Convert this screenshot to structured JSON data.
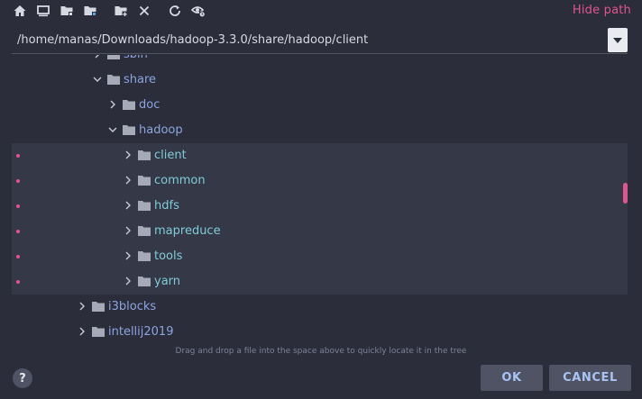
{
  "toolbar": {
    "icons": [
      "home-icon",
      "monitor-icon",
      "folder-up-icon",
      "folder-current-icon",
      "new-folder-icon",
      "delete-icon",
      "refresh-icon",
      "show-hidden-icon"
    ],
    "hide_path_label": "Hide path"
  },
  "path": {
    "value": "/home/manas/Downloads/hadoop-3.3.0/share/hadoop/client"
  },
  "tree": {
    "rows": [
      {
        "label": "sbin",
        "expanded": false,
        "selected": false
      },
      {
        "label": "share",
        "expanded": true,
        "selected": false
      },
      {
        "label": "doc",
        "expanded": false,
        "selected": false
      },
      {
        "label": "hadoop",
        "expanded": true,
        "selected": false
      },
      {
        "label": "client",
        "expanded": false,
        "selected": true
      },
      {
        "label": "common",
        "expanded": false,
        "selected": true
      },
      {
        "label": "hdfs",
        "expanded": false,
        "selected": true
      },
      {
        "label": "mapreduce",
        "expanded": false,
        "selected": true
      },
      {
        "label": "tools",
        "expanded": false,
        "selected": true
      },
      {
        "label": "yarn",
        "expanded": false,
        "selected": true
      },
      {
        "label": "i3blocks",
        "expanded": false,
        "selected": false
      },
      {
        "label": "intellij2019",
        "expanded": false,
        "selected": false
      }
    ]
  },
  "hint": "Drag and drop a file into the space above to quickly locate it in the tree",
  "footer": {
    "help": "?",
    "ok": "OK",
    "cancel": "CANCEL"
  },
  "colors": {
    "background": "#2b2d3a",
    "accent": "#e1558f",
    "label": "#8ea3e0",
    "child_label": "#80cbd8",
    "folder": "#a6aab8"
  }
}
